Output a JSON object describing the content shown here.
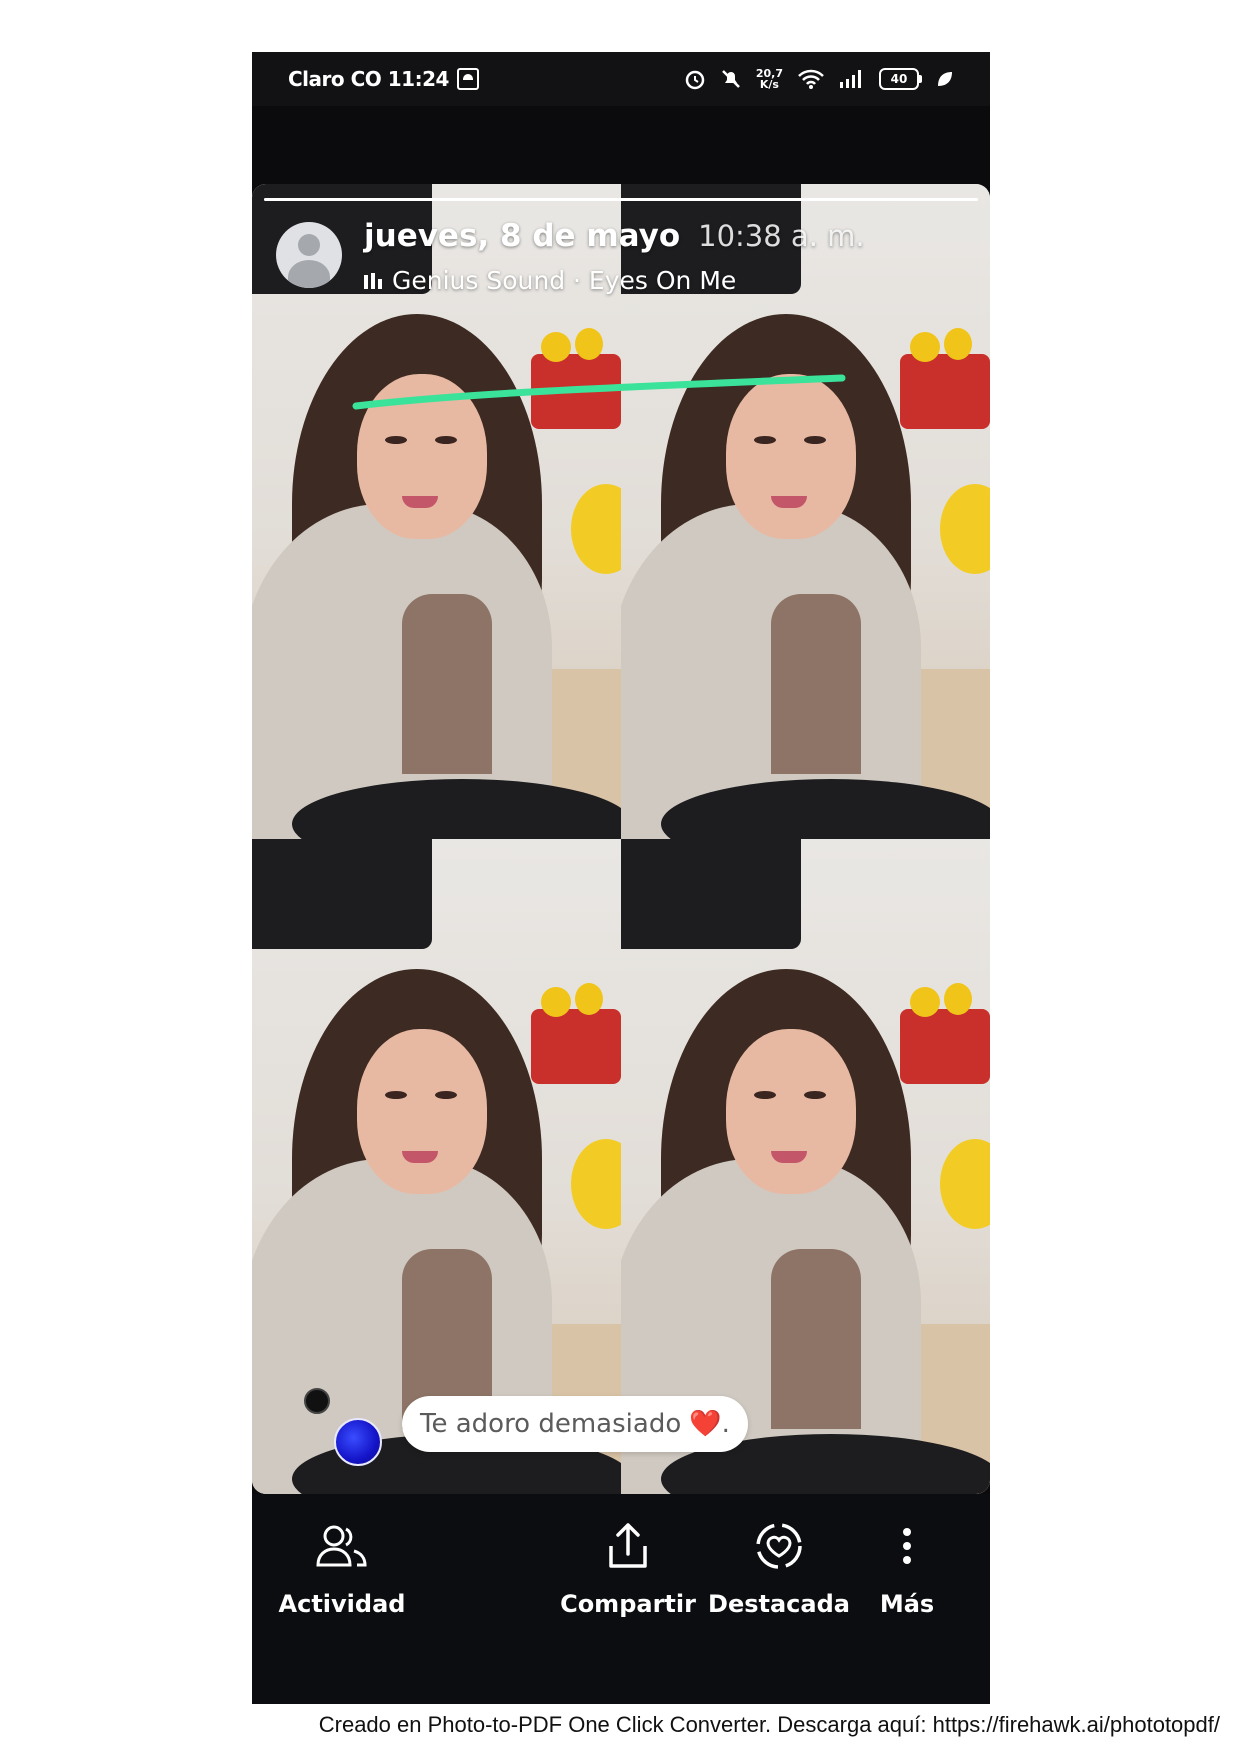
{
  "status_bar": {
    "carrier_time": "Claro CO 11:24",
    "speed_top": "20,7",
    "speed_bottom": "K/s",
    "battery": "40",
    "icons": [
      "notification-icon",
      "alarm-icon",
      "mute-icon",
      "wifi-icon",
      "signal-icon",
      "battery-icon",
      "leaf-icon"
    ]
  },
  "story": {
    "progress": 1.0,
    "date": "jueves, 8 de mayo",
    "time": "10:38 a. m.",
    "music": "Genius Sound · Eyes On Me",
    "annotation_color": "#3be39a",
    "reply": {
      "text": "Te adoro demasiado",
      "emoji": "❤️",
      "suffix": "."
    }
  },
  "bottom_actions": [
    {
      "label": "Actividad",
      "icon": "people-icon"
    },
    {
      "label": "Compartir",
      "icon": "share-icon"
    },
    {
      "label": "Destacada",
      "icon": "highlight-heart-icon"
    },
    {
      "label": "Más",
      "icon": "more-vertical-icon"
    }
  ],
  "footer": {
    "credit": "Creado en Photo-to-PDF One Click Converter. Descarga aquí: https://firehawk.ai/phototopdf/"
  }
}
